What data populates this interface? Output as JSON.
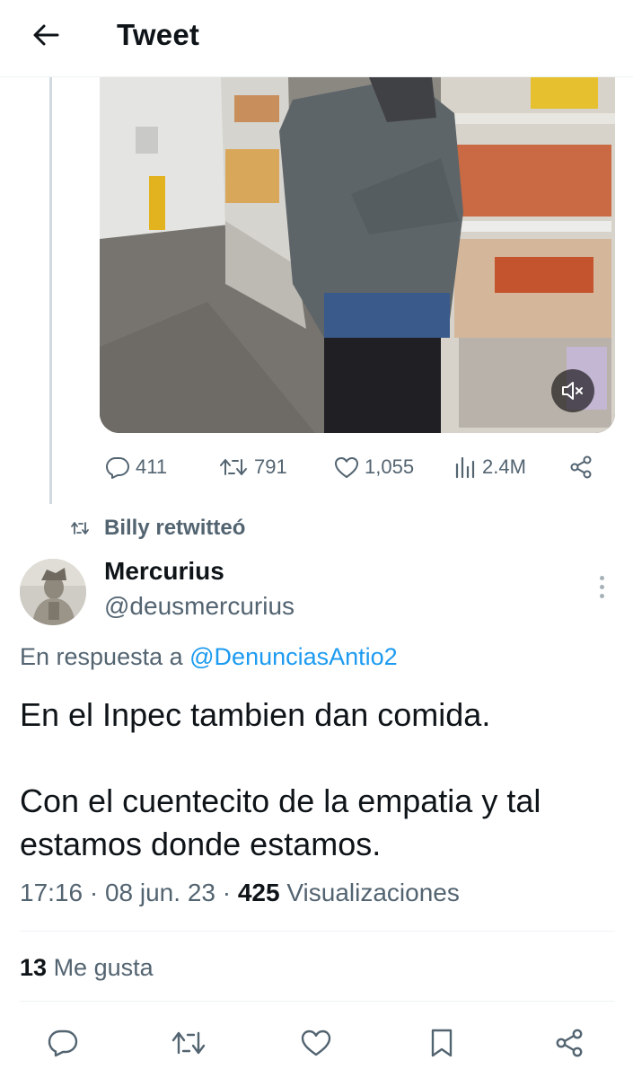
{
  "header": {
    "title": "Tweet"
  },
  "quoted_media": {
    "mute_icon": "muted-speaker-icon"
  },
  "top_actions": {
    "replies": "411",
    "retweets": "791",
    "likes": "1,055",
    "views": "2.4M"
  },
  "retweet_context": {
    "text": "Billy retwitteó"
  },
  "tweet": {
    "author_name": "Mercurius",
    "author_handle": "@deusmercurius",
    "reply_prefix": "En respuesta a",
    "reply_to_handle": "@DenunciasAntio2",
    "text_line1": "En el Inpec tambien dan comida.",
    "text_line2": "Con el cuentecito de la empatia y tal estamos donde estamos.",
    "time": "17:16",
    "date": "08 jun. 23",
    "views_count": "425",
    "views_label": "Visualizaciones",
    "likes_count": "13",
    "likes_label": "Me gusta"
  },
  "colors": {
    "text": "#0f1419",
    "secondary": "#536471",
    "link": "#1d9bf0",
    "divider": "#eff3f4"
  }
}
